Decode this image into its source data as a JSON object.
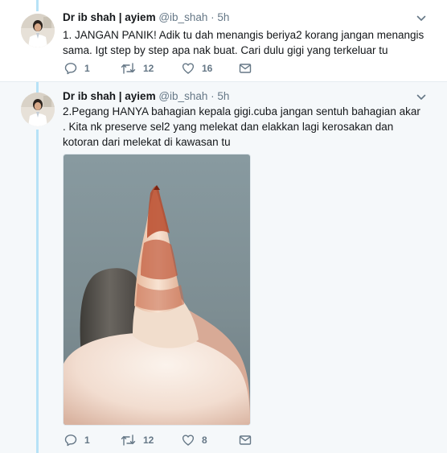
{
  "tweets": [
    {
      "name": "Dr ib shah | ayiem",
      "handle": "@ib_shah",
      "separator": "·",
      "time": "5h",
      "text": "1. JANGAN PANIK! Adik tu dah menangis beriya2 korang jangan menangis sama. Igt step by step apa nak buat. Cari dulu gigi yang terkeluar tu",
      "replies": "1",
      "retweets": "12",
      "likes": "16"
    },
    {
      "name": "Dr ib shah | ayiem",
      "handle": "@ib_shah",
      "separator": "·",
      "time": "5h",
      "text": "2.Pegang HANYA bahagian kepala gigi.cuba jangan sentuh bahagian akar . Kita nk preserve sel2 yang melekat dan elakkan lagi kerosakan dan kotoran dari melekat di kawasan tu",
      "replies": "1",
      "retweets": "12",
      "likes": "8"
    }
  ],
  "colors": {
    "thread_line": "#b7e2f7",
    "icon": "#657786",
    "selected_background": "#f5f8fa"
  },
  "icons": [
    "reply-icon",
    "retweet-icon",
    "like-icon",
    "message-icon",
    "chevron-down-icon"
  ]
}
